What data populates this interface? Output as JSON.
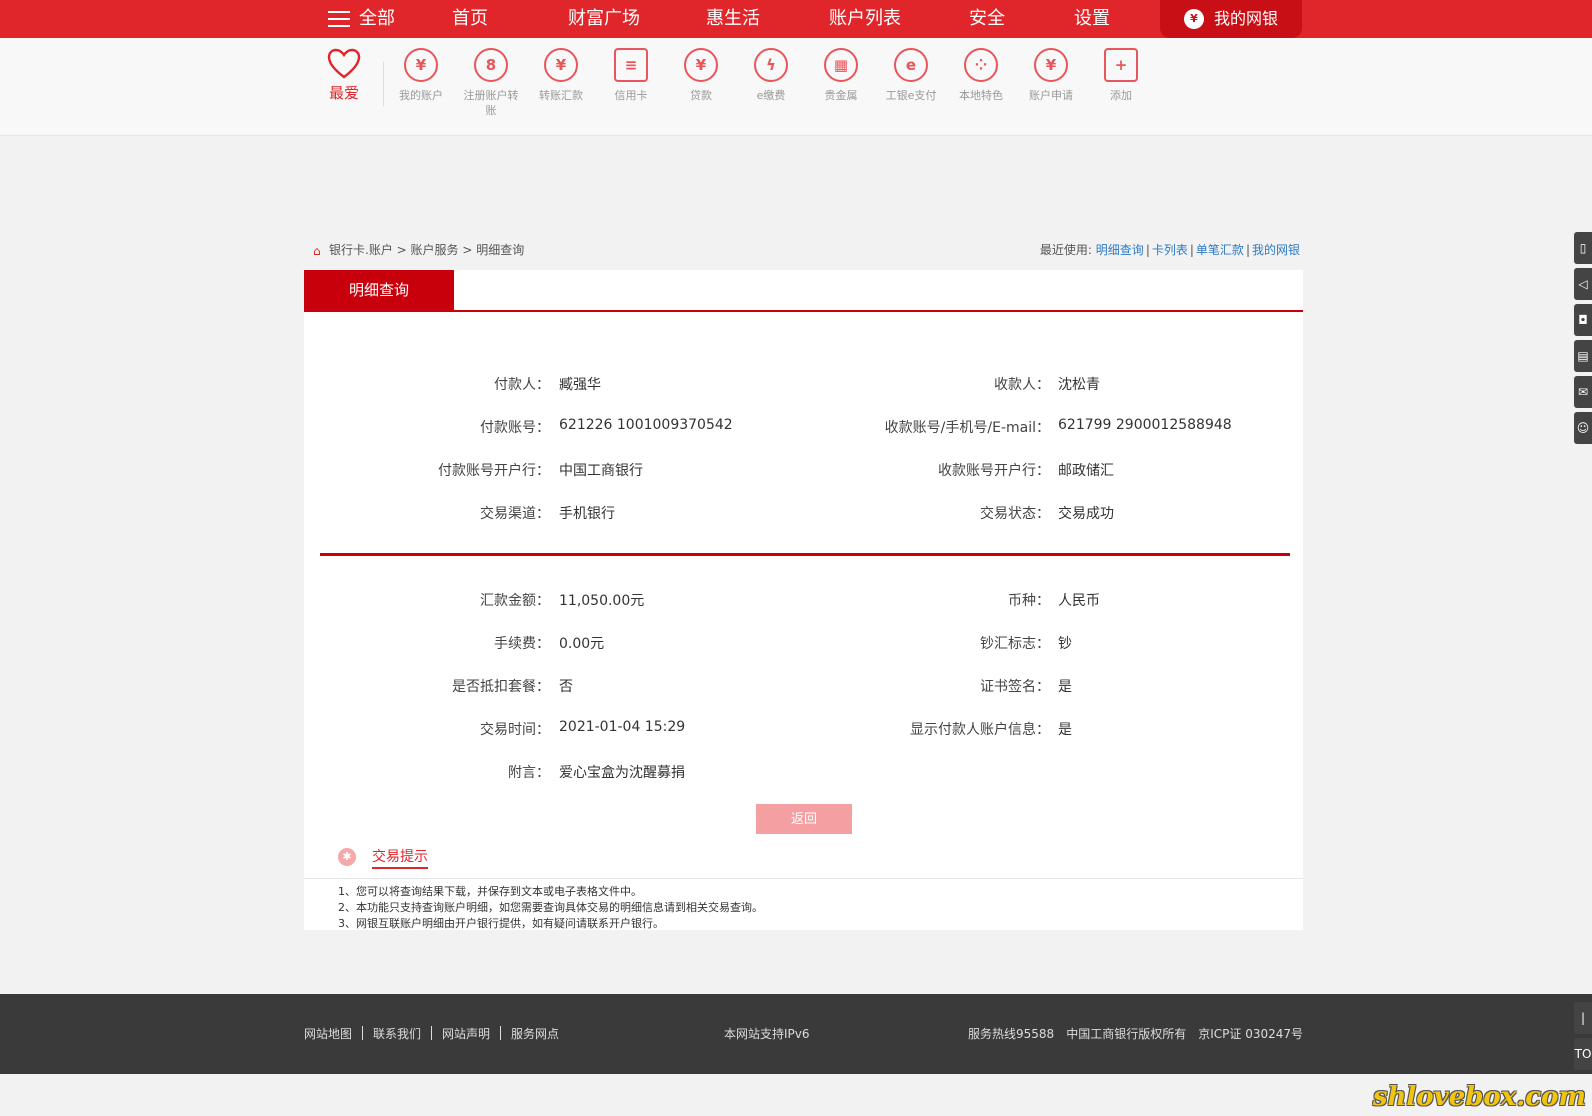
{
  "nav": {
    "all": "全部",
    "items": [
      "首页",
      "财富广场",
      "惠生活",
      "账户列表",
      "安全",
      "设置"
    ],
    "mybank": "我的网银",
    "accent": "#e0262b",
    "mybank_bg": "#c80f16"
  },
  "quick": {
    "fav": "最爱",
    "items": [
      {
        "label": "我的账户",
        "icon": "yen-circle-icon",
        "glyph": "¥"
      },
      {
        "label": "注册账户转账",
        "icon": "refresh-8-icon",
        "glyph": "8"
      },
      {
        "label": "转账汇款",
        "icon": "transfer-yen-icon",
        "glyph": "¥"
      },
      {
        "label": "信用卡",
        "icon": "credit-card-icon",
        "glyph": "≡"
      },
      {
        "label": "贷款",
        "icon": "money-bag-icon",
        "glyph": "¥"
      },
      {
        "label": "e缴费",
        "icon": "flame-bolt-icon",
        "glyph": "ϟ"
      },
      {
        "label": "贵金属",
        "icon": "gold-bars-icon",
        "glyph": "▦"
      },
      {
        "label": "工银e支付",
        "icon": "e-pay-icon",
        "glyph": "e"
      },
      {
        "label": "本地特色",
        "icon": "local-dots-icon",
        "glyph": "⁘"
      },
      {
        "label": "账户申请",
        "icon": "account-apply-icon",
        "glyph": "¥"
      },
      {
        "label": "添加",
        "icon": "plus-square-icon",
        "glyph": "+"
      }
    ]
  },
  "breadcrumb": {
    "items": [
      "银行卡.账户",
      "账户服务",
      "明细查询"
    ],
    "sep": ">",
    "recent_label": "最近使用:",
    "recent": [
      "明细查询",
      "卡列表",
      "单笔汇款",
      "我的网银"
    ]
  },
  "panel": {
    "tab": "明细查询",
    "fields": {
      "payer_label": "付款人：",
      "payer": "臧强华",
      "payee_label": "收款人：",
      "payee": "沈松青",
      "payer_acct_label": "付款账号：",
      "payer_acct": "621226 1001009370542",
      "payee_acct_label": "收款账号/手机号/E-mail：",
      "payee_acct": "621799 2900012588948",
      "payer_bank_label": "付款账号开户行：",
      "payer_bank": "中国工商银行",
      "payee_bank_label": "收款账号开户行：",
      "payee_bank": "邮政储汇",
      "channel_label": "交易渠道：",
      "channel": "手机银行",
      "status_label": "交易状态：",
      "status": "交易成功",
      "amount_label": "汇款金额：",
      "amount": "11,050.00元",
      "currency_label": "币种：",
      "currency": "人民币",
      "fee_label": "手续费：",
      "fee": "0.00元",
      "cash_label": "钞汇标志：",
      "cash": "钞",
      "package_label": "是否抵扣套餐：",
      "package": "否",
      "cert_label": "证书签名：",
      "cert": "是",
      "time_label": "交易时间：",
      "time": "2021-01-04 15:29",
      "show_info_label": "显示付款人账户信息：",
      "show_info": "是",
      "memo_label": "附言：",
      "memo": "爱心宝盒为沈醒募捐"
    },
    "back": "返回"
  },
  "tips": {
    "title": "交易提示",
    "lines": [
      "1、您可以将查询结果下载，并保存到文本或电子表格文件中。",
      "2、本功能只支持查询账户明细，如您需要查询具体交易的明细信息请到相关交易查询。",
      "3、网银互联账户明细由开户银行提供，如有疑问请联系开户银行。"
    ]
  },
  "footer": {
    "links": [
      "网站地图",
      "联系我们",
      "网站声明",
      "服务网点"
    ],
    "center": "本网站支持IPv6",
    "hotline": "服务热线95588",
    "copyright": "中国工商银行版权所有",
    "icp": "京ICP证 030247号"
  },
  "side": {
    "top_label": "TO"
  },
  "watermark": "shlovebox.com"
}
